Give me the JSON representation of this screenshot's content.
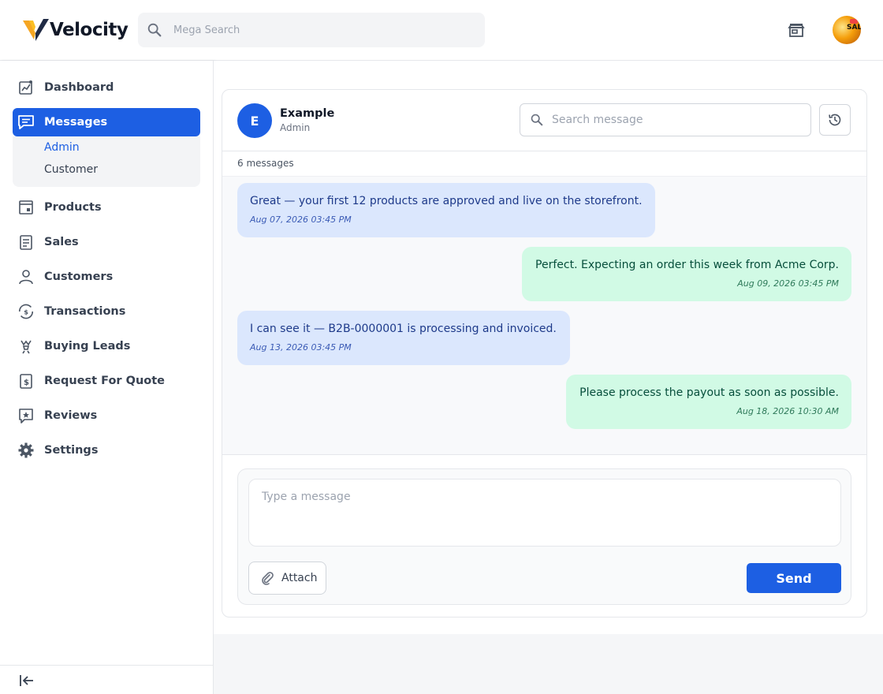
{
  "app": {
    "brand": "Velocity",
    "accent_color": "#1d5fe3"
  },
  "header": {
    "search_placeholder": "Mega Search",
    "store_icon": "storefront-icon",
    "avatar_badge": "SAL"
  },
  "sidebar": {
    "items": [
      {
        "label": "Dashboard",
        "icon": "dashboard-chart-icon"
      },
      {
        "label": "Messages",
        "icon": "message-icon",
        "active": true
      },
      {
        "label": "Products",
        "icon": "products-icon"
      },
      {
        "label": "Sales",
        "icon": "sales-clipboard-icon"
      },
      {
        "label": "Customers",
        "icon": "person-icon"
      },
      {
        "label": "Transactions",
        "icon": "transactions-icon"
      },
      {
        "label": "Buying Leads",
        "icon": "buying-leads-icon"
      },
      {
        "label": "Request For Quote",
        "icon": "quote-icon"
      },
      {
        "label": "Reviews",
        "icon": "reviews-star-icon"
      },
      {
        "label": "Settings",
        "icon": "gear-icon"
      }
    ],
    "messages_sub": [
      {
        "label": "Admin",
        "selected": true
      },
      {
        "label": "Customer",
        "selected": false
      }
    ],
    "collapse_icon": "collapse-sidebar-icon"
  },
  "chat": {
    "contact": {
      "initial": "E",
      "name": "Example",
      "role": "Admin"
    },
    "search_placeholder": "Search message",
    "history_icon": "history-icon",
    "count_text": "6 messages",
    "messages": [
      {
        "direction": "in",
        "text": "Great — your first 12 products are approved and live on the storefront.",
        "time": "Aug 07, 2026 03:45 PM"
      },
      {
        "direction": "out",
        "text": "Perfect. Expecting an order this week from Acme Corp.",
        "time": "Aug 09, 2026 03:45 PM"
      },
      {
        "direction": "in",
        "text": "I can see it — B2B-0000001 is processing and invoiced.",
        "time": "Aug 13, 2026 03:45 PM"
      },
      {
        "direction": "out",
        "text": "Please process the payout as soon as possible.",
        "time": "Aug 18, 2026 10:30 AM"
      }
    ],
    "composer": {
      "placeholder": "Type a message",
      "attach_label": "Attach",
      "send_label": "Send"
    }
  }
}
